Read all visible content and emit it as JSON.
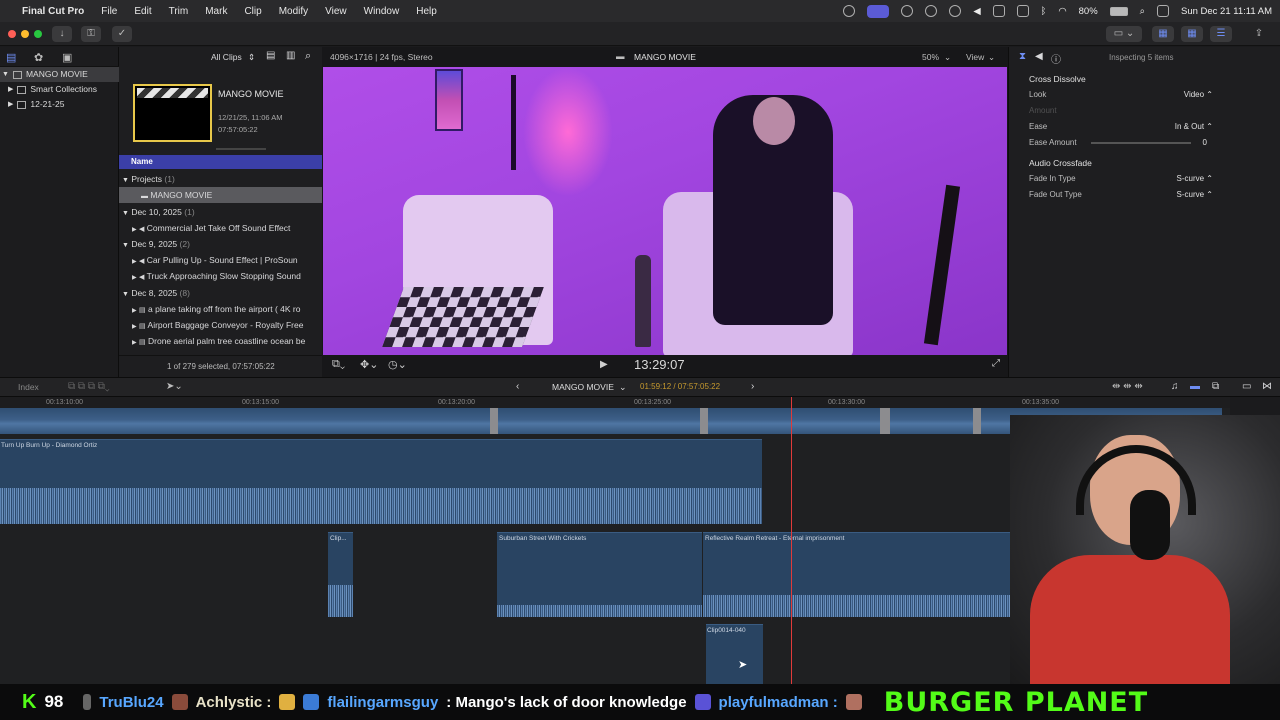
{
  "menubar": {
    "app": "Final Cut Pro",
    "items": [
      "File",
      "Edit",
      "Trim",
      "Mark",
      "Clip",
      "Modify",
      "View",
      "Window",
      "Help"
    ],
    "battery": "80%",
    "datetime": "Sun Dec 21  11:11 AM"
  },
  "library": {
    "rows": [
      "MANGO MOVIE",
      "Smart Collections",
      "12-21-25"
    ]
  },
  "browser": {
    "filter": "All Clips",
    "project_name": "MANGO MOVIE",
    "project_date": "12/21/25, 11:06 AM",
    "project_duration": "07:57:05:22",
    "column_name": "Name",
    "groups": [
      {
        "label": "Projects",
        "count": "(1)",
        "items": [
          "MANGO MOVIE"
        ]
      },
      {
        "label": "Dec 10, 2025",
        "count": "(1)",
        "items": [
          "Commercial Jet Take Off Sound Effect"
        ]
      },
      {
        "label": "Dec 9, 2025",
        "count": "(2)",
        "items": [
          "Car Pulling Up - Sound Effect  |  ProSoun",
          "Truck Approaching Slow Stopping Sound"
        ]
      },
      {
        "label": "Dec 8, 2025",
        "count": "(8)",
        "items": [
          "a plane taking off from the airport ( 4K ro",
          "Airport Baggage Conveyor - Royalty Free",
          "Drone aerial palm tree coastline ocean be"
        ]
      }
    ],
    "status": "1 of 279 selected, 07:57:05:22"
  },
  "viewer": {
    "format": "4096×1716 | 24 fps, Stereo",
    "title": "MANGO MOVIE",
    "zoom": "50%",
    "view_label": "View",
    "timecode": "13:29:07"
  },
  "inspector": {
    "header": "Inspecting 5 items",
    "section": "Cross Dissolve",
    "rows": [
      {
        "label": "Look",
        "value": "Video ⌃"
      },
      {
        "label": "Amount",
        "value": ""
      },
      {
        "label": "Ease",
        "value": "In & Out ⌃"
      },
      {
        "label": "Ease Amount",
        "value": "0"
      }
    ],
    "section2": "Audio Crossfade",
    "rows2": [
      {
        "label": "Fade In Type",
        "value": "S-curve ⌃"
      },
      {
        "label": "Fade Out Type",
        "value": "S-curve ⌃"
      }
    ]
  },
  "timeline": {
    "index_label": "Index",
    "project": "MANGO MOVIE",
    "position": "01:59:12 / 07:57:05:22",
    "ruler": [
      "00:13:10:00",
      "00:13:15:00",
      "00:13:20:00",
      "00:13:25:00",
      "00:13:30:00",
      "00:13:35:00"
    ],
    "clips": {
      "music": "Turn Up Burn Up - Diamond Ortiz",
      "clip_a": "Clip...",
      "street": "Suburban Street With Crickets",
      "reflective": "Reflective Realm Retreat - Eternal imprisonment",
      "clip_b": "Clip0014-040"
    }
  },
  "ticker": {
    "count": "98",
    "items": [
      {
        "user": "TruBlu24",
        "text": ""
      },
      {
        "user": "Achlystic :",
        "text": ""
      },
      {
        "user": "flailingarmsguy",
        "text": ": Mango's lack of door knowledge"
      },
      {
        "user": "playfulmadman :",
        "text": ""
      }
    ],
    "brand": "BURGER PLANET"
  }
}
